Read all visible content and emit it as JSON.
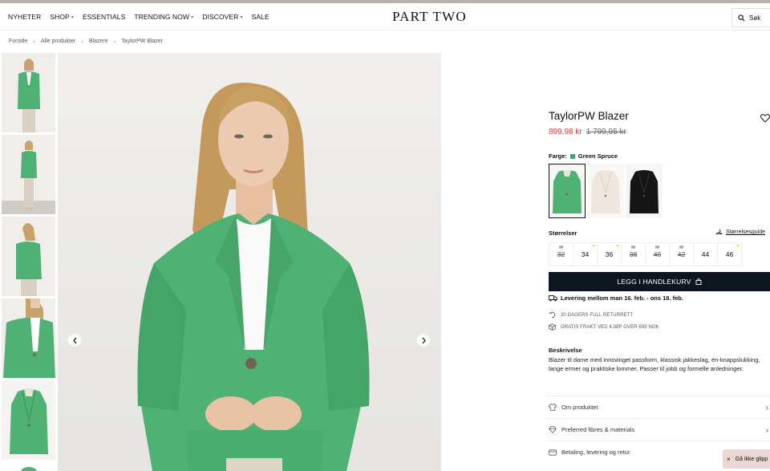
{
  "nav": {
    "items": [
      {
        "label": "NYHETER",
        "caret": false
      },
      {
        "label": "SHOP",
        "caret": true
      },
      {
        "label": "ESSENTIALS",
        "caret": false
      },
      {
        "label": "TRENDING NOW",
        "caret": true
      },
      {
        "label": "DISCOVER",
        "caret": true
      },
      {
        "label": "SALE",
        "caret": false
      }
    ],
    "logo": "PART TWO",
    "search_label": "Søk"
  },
  "breadcrumb": [
    "Forside",
    "Alle produkter",
    "Blazere",
    "TaylorPW Blazer"
  ],
  "product": {
    "title": "TaylorPW Blazer",
    "price_now": "899,98 kr",
    "price_old": "1 799,95 kr",
    "color_label": "Farge:",
    "color_name": "Green Spruce",
    "sizes_label": "Størrelser",
    "size_guide": "Størrelsesguide",
    "sizes": [
      {
        "label": "32",
        "struck": true,
        "mail": true,
        "dot": false
      },
      {
        "label": "34",
        "struck": false,
        "mail": false,
        "dot": true
      },
      {
        "label": "36",
        "struck": false,
        "mail": false,
        "dot": true
      },
      {
        "label": "38",
        "struck": true,
        "mail": true,
        "dot": false
      },
      {
        "label": "40",
        "struck": true,
        "mail": true,
        "dot": false
      },
      {
        "label": "42",
        "struck": true,
        "mail": true,
        "dot": false
      },
      {
        "label": "44",
        "struck": false,
        "mail": false,
        "dot": false
      },
      {
        "label": "46",
        "struck": false,
        "mail": false,
        "dot": true
      }
    ],
    "cart_button": "LEGG I HANDLEKURV",
    "delivery": "Levering mellom man 16. feb. - ons 18. feb.",
    "perk_returns": "30 DAGERS FULL RETURRETT",
    "perk_shipping": "GRATIS FRAKT VED KJØP OVER 699 NOK",
    "description_title": "Beskrivelse",
    "description": "Blazer til dame med innsvinget passform, klassisk jakkeslag, én-knappslukking, lange ermer og praktiske lommer. Passer til jobb og formelle anledninger.",
    "accordion": [
      "Om produktet",
      "Preferred fibres & materials",
      "Betaling, levering og retur"
    ]
  },
  "popup": {
    "close": "×",
    "text": "Gå ikke glipp"
  },
  "colors": {
    "accent_red": "#e03c3c",
    "button_dark": "#0d1422",
    "blazer_green": "#4fb174",
    "swatch_green": "#45a66a"
  }
}
